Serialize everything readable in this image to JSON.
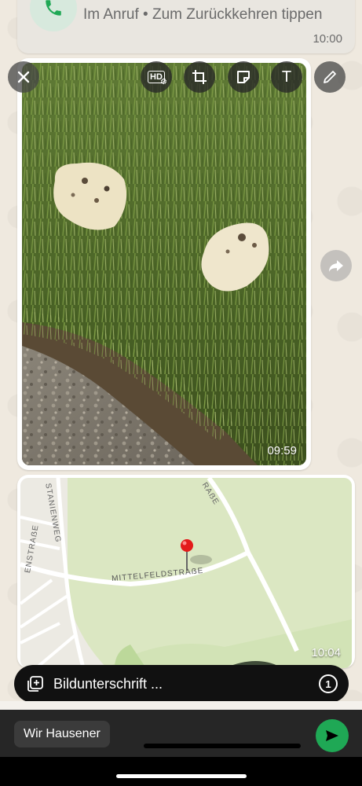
{
  "call_banner": {
    "subtitle": "Im Anruf • Zum Zurückkehren tippen",
    "time": "10:00"
  },
  "photo_message": {
    "time": "09:59"
  },
  "toolbar": {
    "hd_label": "HD",
    "text_tool_label": "T"
  },
  "map_message": {
    "streets": [
      "STANIENWEG",
      "MITTELFELDSTRAẞE",
      "RAẞE",
      "ENSTRAẞE"
    ],
    "time": "10:04"
  },
  "caption": {
    "placeholder": "Bildunterschrift ...",
    "view_once_label": "1"
  },
  "recipient": {
    "name": "Wir Hausener"
  },
  "colors": {
    "send_green": "#1fa855",
    "dark_bar": "#262626"
  }
}
